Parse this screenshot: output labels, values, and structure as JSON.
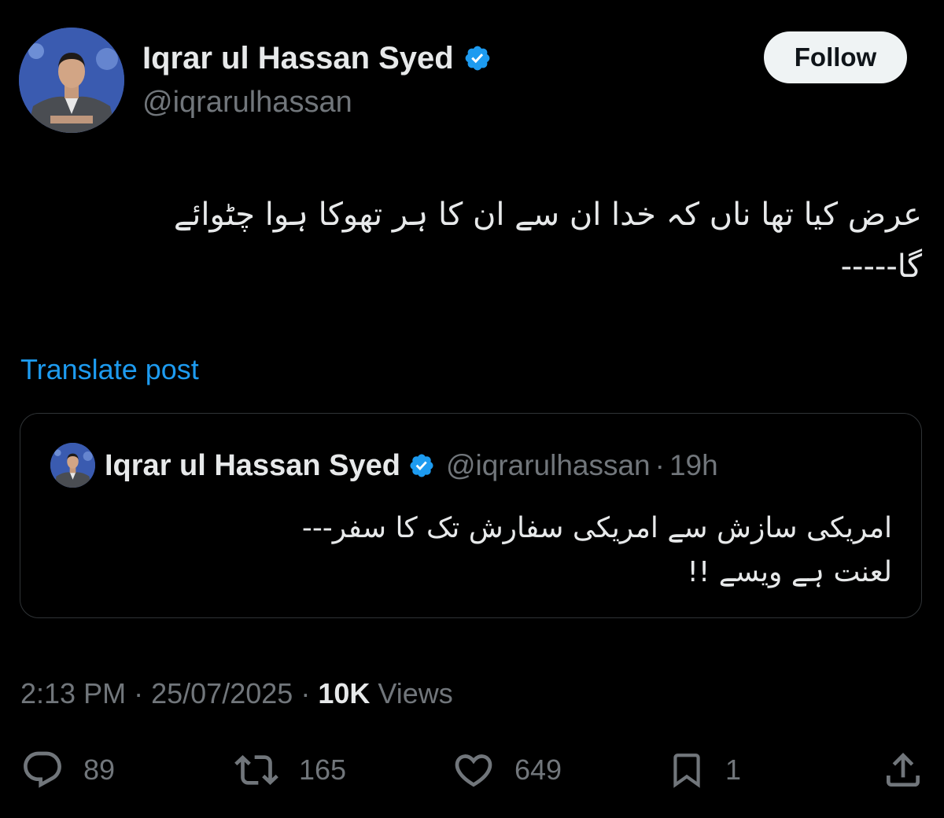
{
  "post": {
    "author_name": "Iqrar ul Hassan Syed",
    "author_handle": "@iqrarulhassan",
    "follow_label": "Follow",
    "text_lines": [
      "عرض کیا تھا ناں کہ خدا ان سے ان کا ہر تھوکا ہوا چٹوائے",
      "گا-----"
    ],
    "translate_label": "Translate post",
    "time": "2:13 PM",
    "date": "25/07/2025",
    "views_count": "10K",
    "views_label": "Views"
  },
  "quote": {
    "author_name": "Iqrar ul Hassan Syed",
    "author_handle": "@iqrarulhassan",
    "separator": "·",
    "time_ago": "19h",
    "text_lines": [
      "امریکی سازش سے امریکی سفارش تک کا سفر---",
      "لعنت ہے ویسے !!"
    ]
  },
  "meta": {
    "separator": "·"
  },
  "actions": {
    "replies": "89",
    "reposts": "165",
    "likes": "649",
    "bookmarks": "1"
  },
  "colors": {
    "background": "#000000",
    "text_primary": "#e7e9ea",
    "text_secondary": "#71767b",
    "accent": "#1d9bf0",
    "border": "#2f3336",
    "follow_bg": "#eff3f4"
  },
  "icons": {
    "verified": "verified-badge-icon",
    "reply": "reply-icon",
    "repost": "repost-icon",
    "like": "heart-icon",
    "bookmark": "bookmark-icon",
    "share": "share-icon"
  }
}
